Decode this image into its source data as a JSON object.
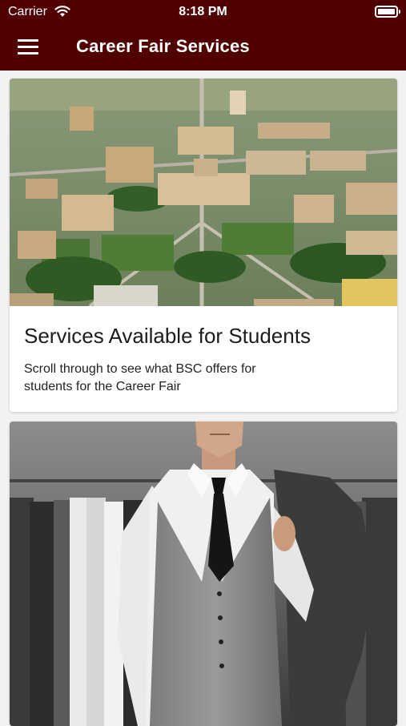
{
  "status_bar": {
    "carrier": "Carrier",
    "time": "8:18 PM"
  },
  "header": {
    "title": "Career Fair Services",
    "background_color": "#500000"
  },
  "cards": [
    {
      "title": "Services Available for Students",
      "description": "Scroll through to see what BSC offers for students for the Career Fair",
      "image": "aerial-campus-photo"
    },
    {
      "image": "man-in-suit-vest-photo"
    }
  ]
}
